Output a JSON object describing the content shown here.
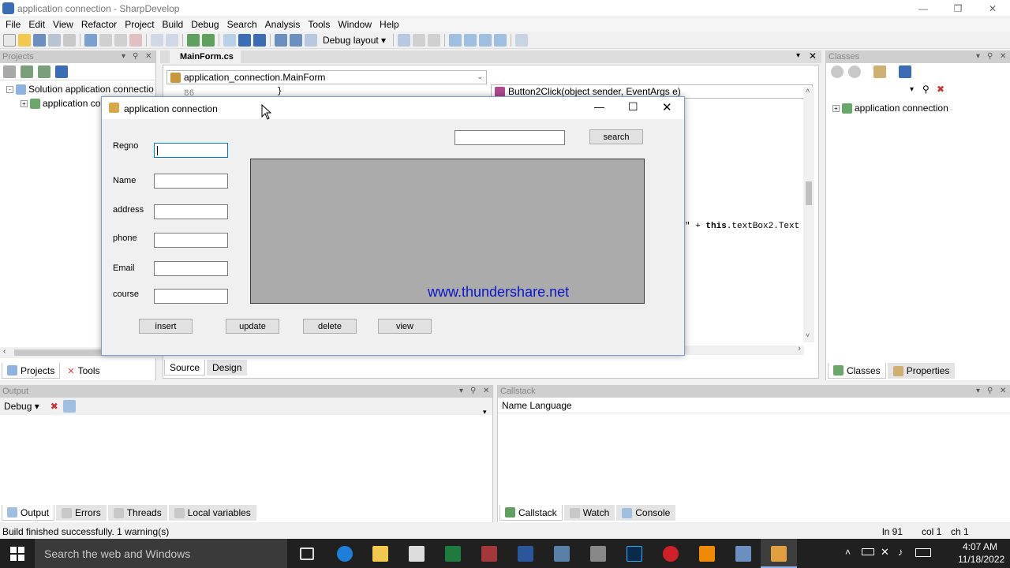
{
  "window": {
    "title": "application connection - SharpDevelop"
  },
  "menu": [
    "File",
    "Edit",
    "View",
    "Refactor",
    "Project",
    "Build",
    "Debug",
    "Search",
    "Analysis",
    "Tools",
    "Window",
    "Help"
  ],
  "toolbar": {
    "layout_label": "Debug layout"
  },
  "projects": {
    "title": "Projects",
    "tree": [
      "Solution application connectio",
      "application co"
    ],
    "tabs": [
      "Projects",
      "Tools"
    ]
  },
  "editor": {
    "tab": "MainForm.cs",
    "class_combo": "application_connection.MainForm",
    "member_combo": "Button2Click(object sender, EventArgs e)",
    "line_no": "86",
    "brace": "}",
    "code_fragment_prefix": "\" + ",
    "code_fragment_keyword": "this",
    "code_fragment_suffix": ".textBox2.Text",
    "bottom_tabs": [
      "Source",
      "Design"
    ]
  },
  "classes": {
    "title": "Classes",
    "tree": [
      "application connection"
    ],
    "tabs": [
      "Classes",
      "Properties"
    ]
  },
  "output": {
    "title": "Output",
    "combo": "Debug",
    "tabs": [
      "Output",
      "Errors",
      "Threads",
      "Local variables"
    ]
  },
  "callstack": {
    "title": "Callstack",
    "columns": "Name Language",
    "tabs": [
      "Callstack",
      "Watch",
      "Console"
    ]
  },
  "status": {
    "message": "Build finished successfully. 1 warning(s)",
    "ln": "ln 91",
    "col": "col 1",
    "ch": "ch 1"
  },
  "dialog": {
    "title": "application connection",
    "labels": [
      "Regno",
      "Name",
      "address",
      "phone",
      "Email",
      "course"
    ],
    "search_button": "search",
    "buttons": [
      "insert",
      "update",
      "delete",
      "view"
    ],
    "watermark": "www.thundershare.net"
  },
  "taskbar": {
    "search_placeholder": "Search the web and Windows",
    "time": "4:07 AM",
    "date": "11/18/2022"
  },
  "colors": {
    "accent": "#0078d7",
    "watermark": "#0b16c8",
    "taskbar": "#202020"
  }
}
